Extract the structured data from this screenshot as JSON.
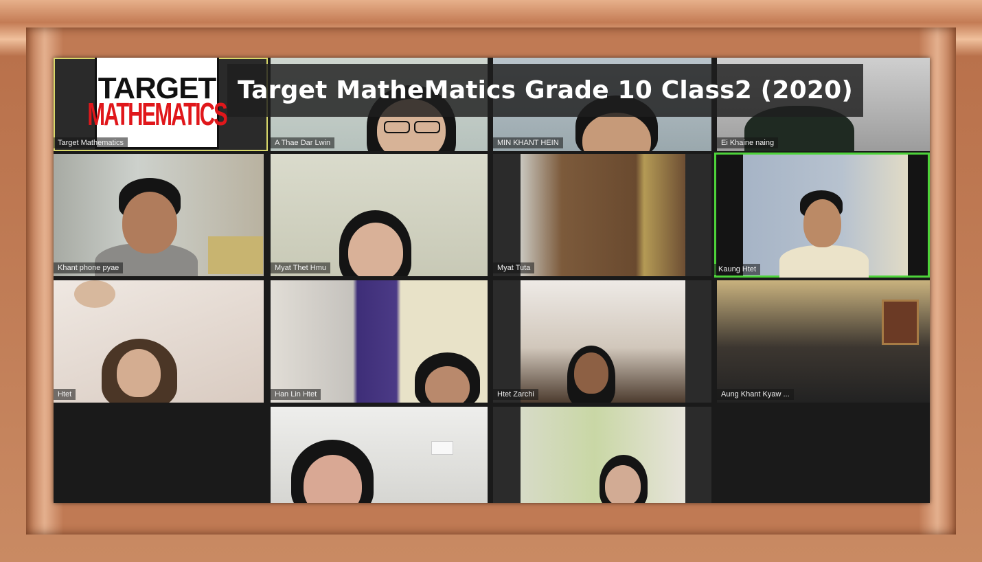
{
  "title": "Target MatheMatics Grade 10 Class2 (2020)",
  "logo": {
    "line1": "TARGET",
    "line2": "MATHEMATICS"
  },
  "participants": [
    {
      "name": "Target  Mathematics"
    },
    {
      "name": "A Thae Dar Lwin"
    },
    {
      "name": "MIN KHANT HEIN"
    },
    {
      "name": "Ei Khaine naing"
    },
    {
      "name": "Khant phone pyae"
    },
    {
      "name": "Myat Thet Hmu"
    },
    {
      "name": "Myat Tuta"
    },
    {
      "name": "Kaung Htet"
    },
    {
      "name": "Htet"
    },
    {
      "name": "Han Lin Htet"
    },
    {
      "name": "Htet Zarchi"
    },
    {
      "name": "Aung Khant Kyaw ..."
    }
  ],
  "colors": {
    "active_speaker": "#4dd33a",
    "logo_red": "#e0171b"
  }
}
